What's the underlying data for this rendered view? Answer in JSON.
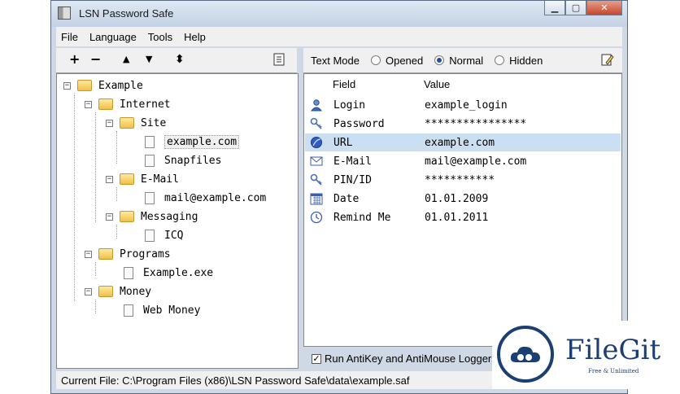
{
  "window": {
    "title": "LSN Password Safe"
  },
  "menu": [
    "File",
    "Language",
    "Tools",
    "Help"
  ],
  "tree_toolbar": {
    "add": "+",
    "remove": "−",
    "up": "▲",
    "down": "▼",
    "updown": "⬍"
  },
  "text_mode": {
    "label": "Text Mode",
    "options": [
      "Opened",
      "Normal",
      "Hidden"
    ],
    "selected": "Normal"
  },
  "tree": [
    {
      "label": "Example",
      "type": "folder",
      "level": 0
    },
    {
      "label": "Internet",
      "type": "folder",
      "level": 1
    },
    {
      "label": "Site",
      "type": "folder",
      "level": 2
    },
    {
      "label": "example.com",
      "type": "doc",
      "level": 3,
      "selected": true
    },
    {
      "label": "Snapfiles",
      "type": "doc",
      "level": 3
    },
    {
      "label": "E-Mail",
      "type": "folder",
      "level": 2
    },
    {
      "label": "mail@example.com",
      "type": "doc",
      "level": 3
    },
    {
      "label": "Messaging",
      "type": "folder",
      "level": 2
    },
    {
      "label": "ICQ",
      "type": "doc",
      "level": 3
    },
    {
      "label": "Programs",
      "type": "folder",
      "level": 1
    },
    {
      "label": "Example.exe",
      "type": "doc",
      "level": 2
    },
    {
      "label": "Money",
      "type": "folder",
      "level": 1
    },
    {
      "label": "Web Money",
      "type": "doc",
      "level": 2
    }
  ],
  "fields": {
    "header_field": "Field",
    "header_value": "Value",
    "rows": [
      {
        "name": "Login",
        "value": "example_login",
        "icon": "user-icon"
      },
      {
        "name": "Password",
        "value": "****************",
        "icon": "key-icon"
      },
      {
        "name": "URL",
        "value": "example.com",
        "icon": "globe-icon",
        "selected": true
      },
      {
        "name": "E-Mail",
        "value": "mail@example.com",
        "icon": "envelope-icon"
      },
      {
        "name": "PIN/ID",
        "value": "***********",
        "icon": "key-icon"
      },
      {
        "name": "Date",
        "value": "01.01.2009",
        "icon": "calendar-icon"
      },
      {
        "name": "Remind Me",
        "value": "01.01.2011",
        "icon": "clock-icon"
      }
    ]
  },
  "antikey": {
    "label": "Run AntiKey and AntiMouse Loggers",
    "checked": true
  },
  "status": {
    "text": "Current File: C:\\Program Files (x86)\\LSN Password Safe\\data\\example.saf"
  },
  "watermark": {
    "title": "FileGit",
    "subtitle": "Free & Unlimited"
  }
}
